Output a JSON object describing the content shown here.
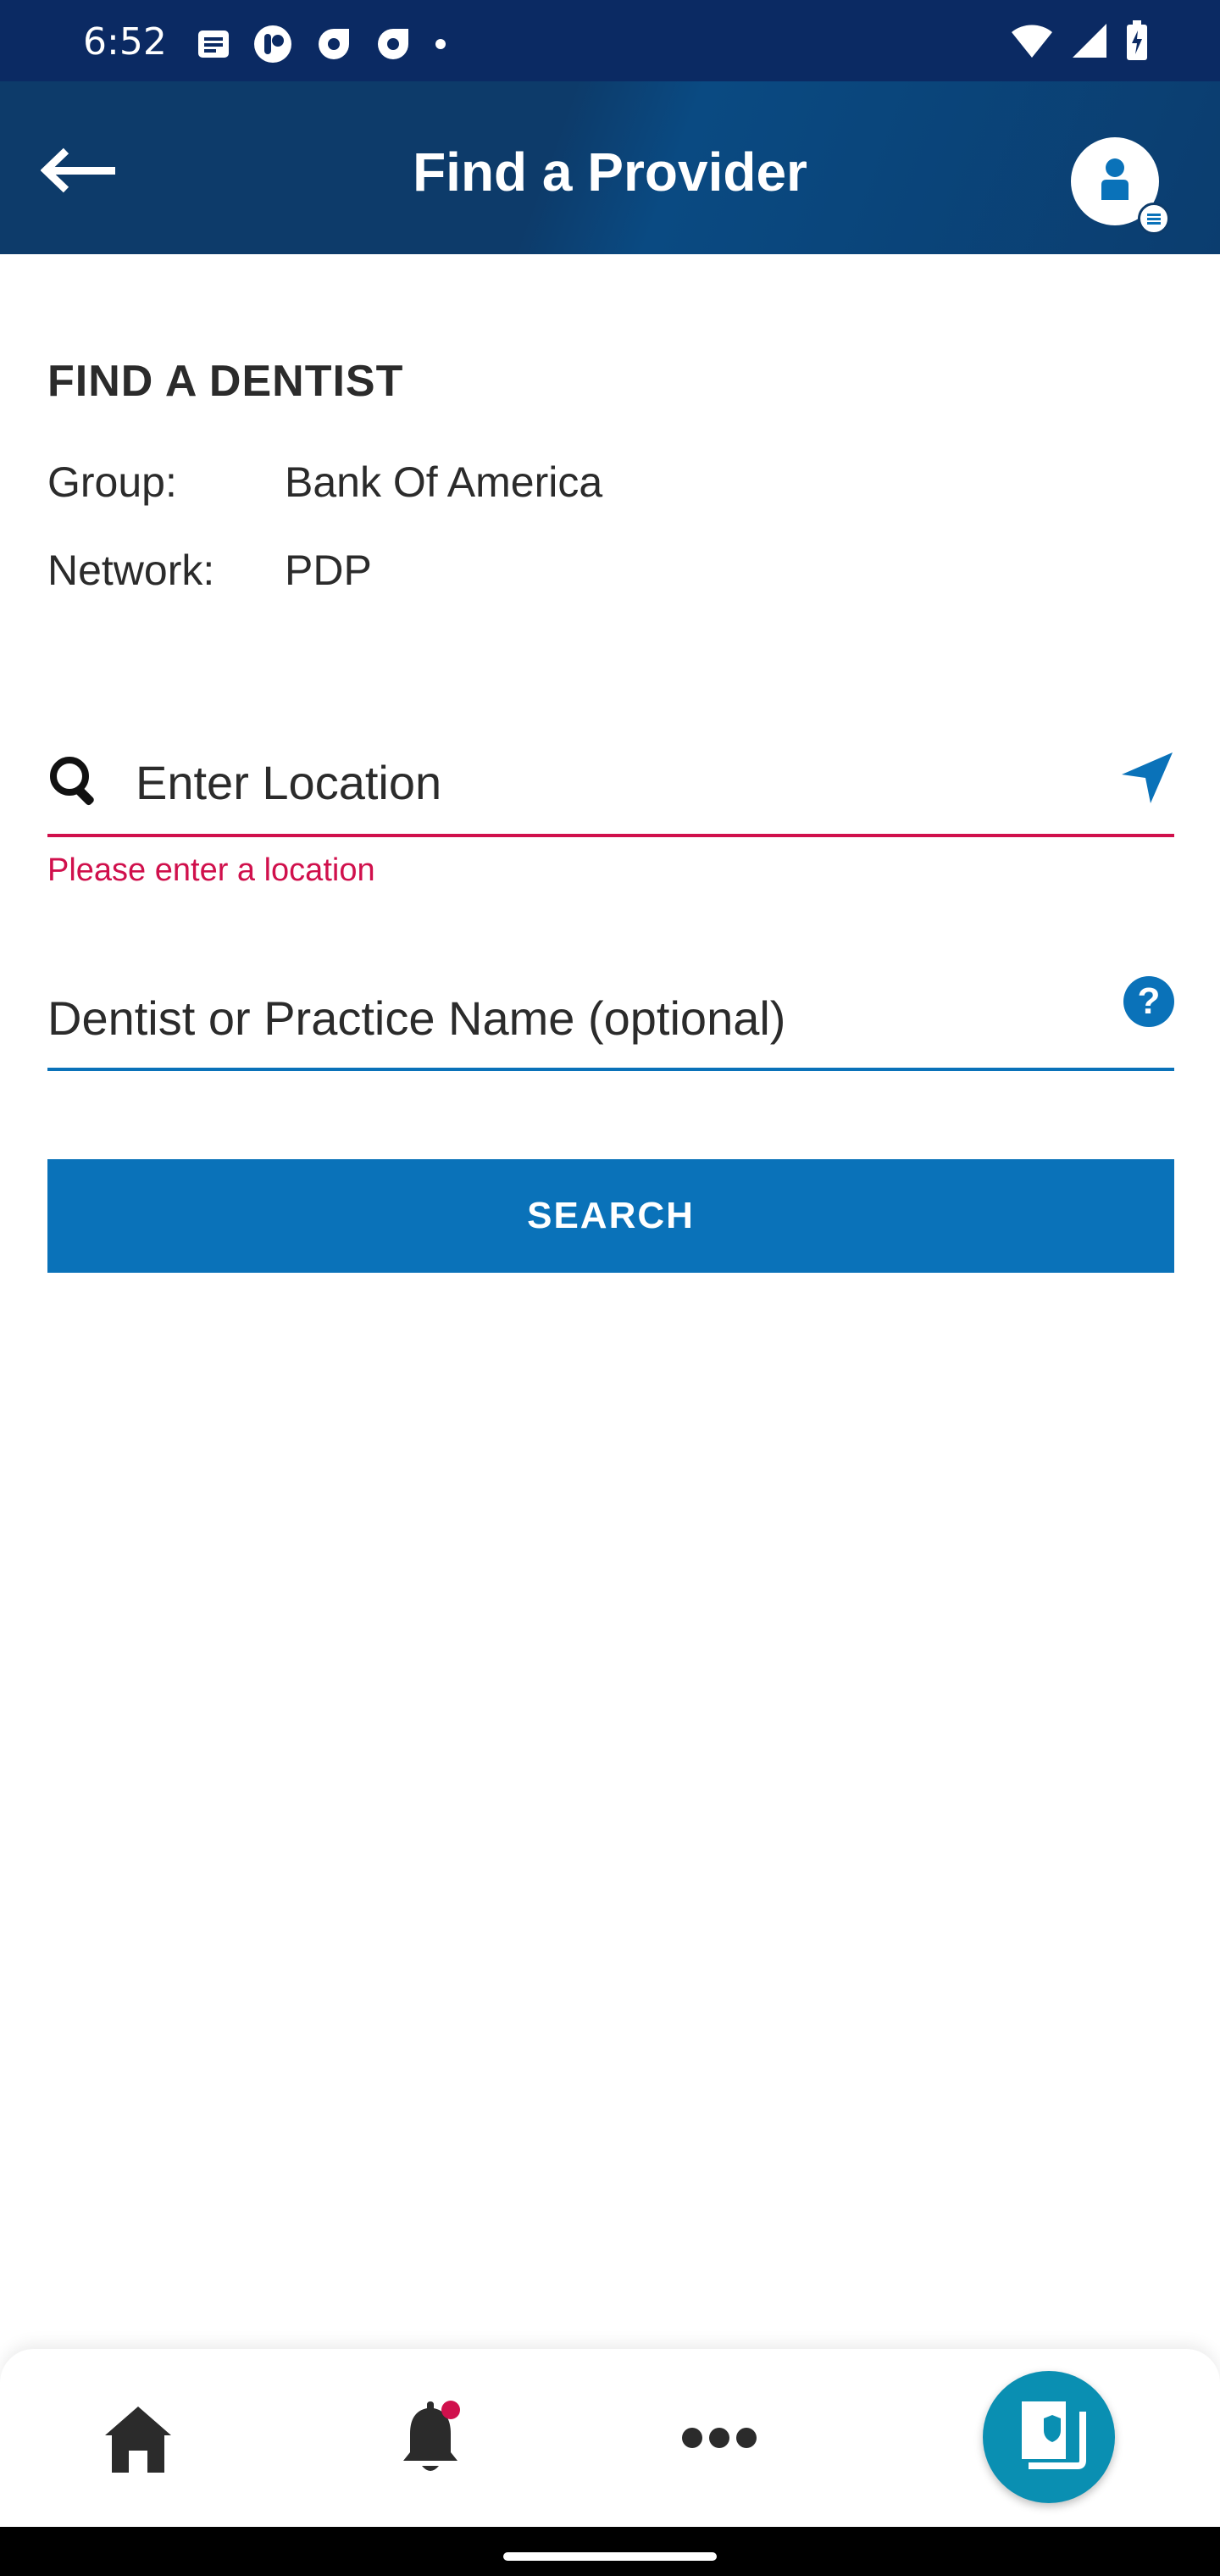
{
  "status_bar": {
    "time": "6:52",
    "left_icons": [
      "message-icon",
      "app-notification-icon",
      "app-notification-icon",
      "app-notification-icon",
      "dot-icon"
    ],
    "right_icons": [
      "wifi-icon",
      "signal-icon",
      "battery-icon"
    ]
  },
  "app_bar": {
    "title": "Find a Provider",
    "back_icon": "back-arrow-icon",
    "profile_icon": "user-avatar-icon"
  },
  "form": {
    "section_title": "FIND A DENTIST",
    "group_label": "Group:",
    "group_value": "Bank Of America",
    "network_label": "Network:",
    "network_value": "PDP",
    "location_placeholder": "Enter Location",
    "location_value": "",
    "location_error": "Please enter a location",
    "name_placeholder": "Dentist or Practice Name (optional)",
    "name_value": "",
    "help_icon_label": "?",
    "search_label": "SEARCH"
  },
  "bottom_nav": {
    "items": [
      {
        "icon": "home-icon"
      },
      {
        "icon": "bell-icon",
        "has_badge": true
      },
      {
        "icon": "more-icon"
      },
      {
        "icon": "id-card-icon"
      }
    ]
  },
  "colors": {
    "status_bar": "#0b2a63",
    "app_bar": "#0d3b6a",
    "primary": "#0a72b9",
    "error": "#d0104c",
    "fab": "#0a8fb2"
  }
}
